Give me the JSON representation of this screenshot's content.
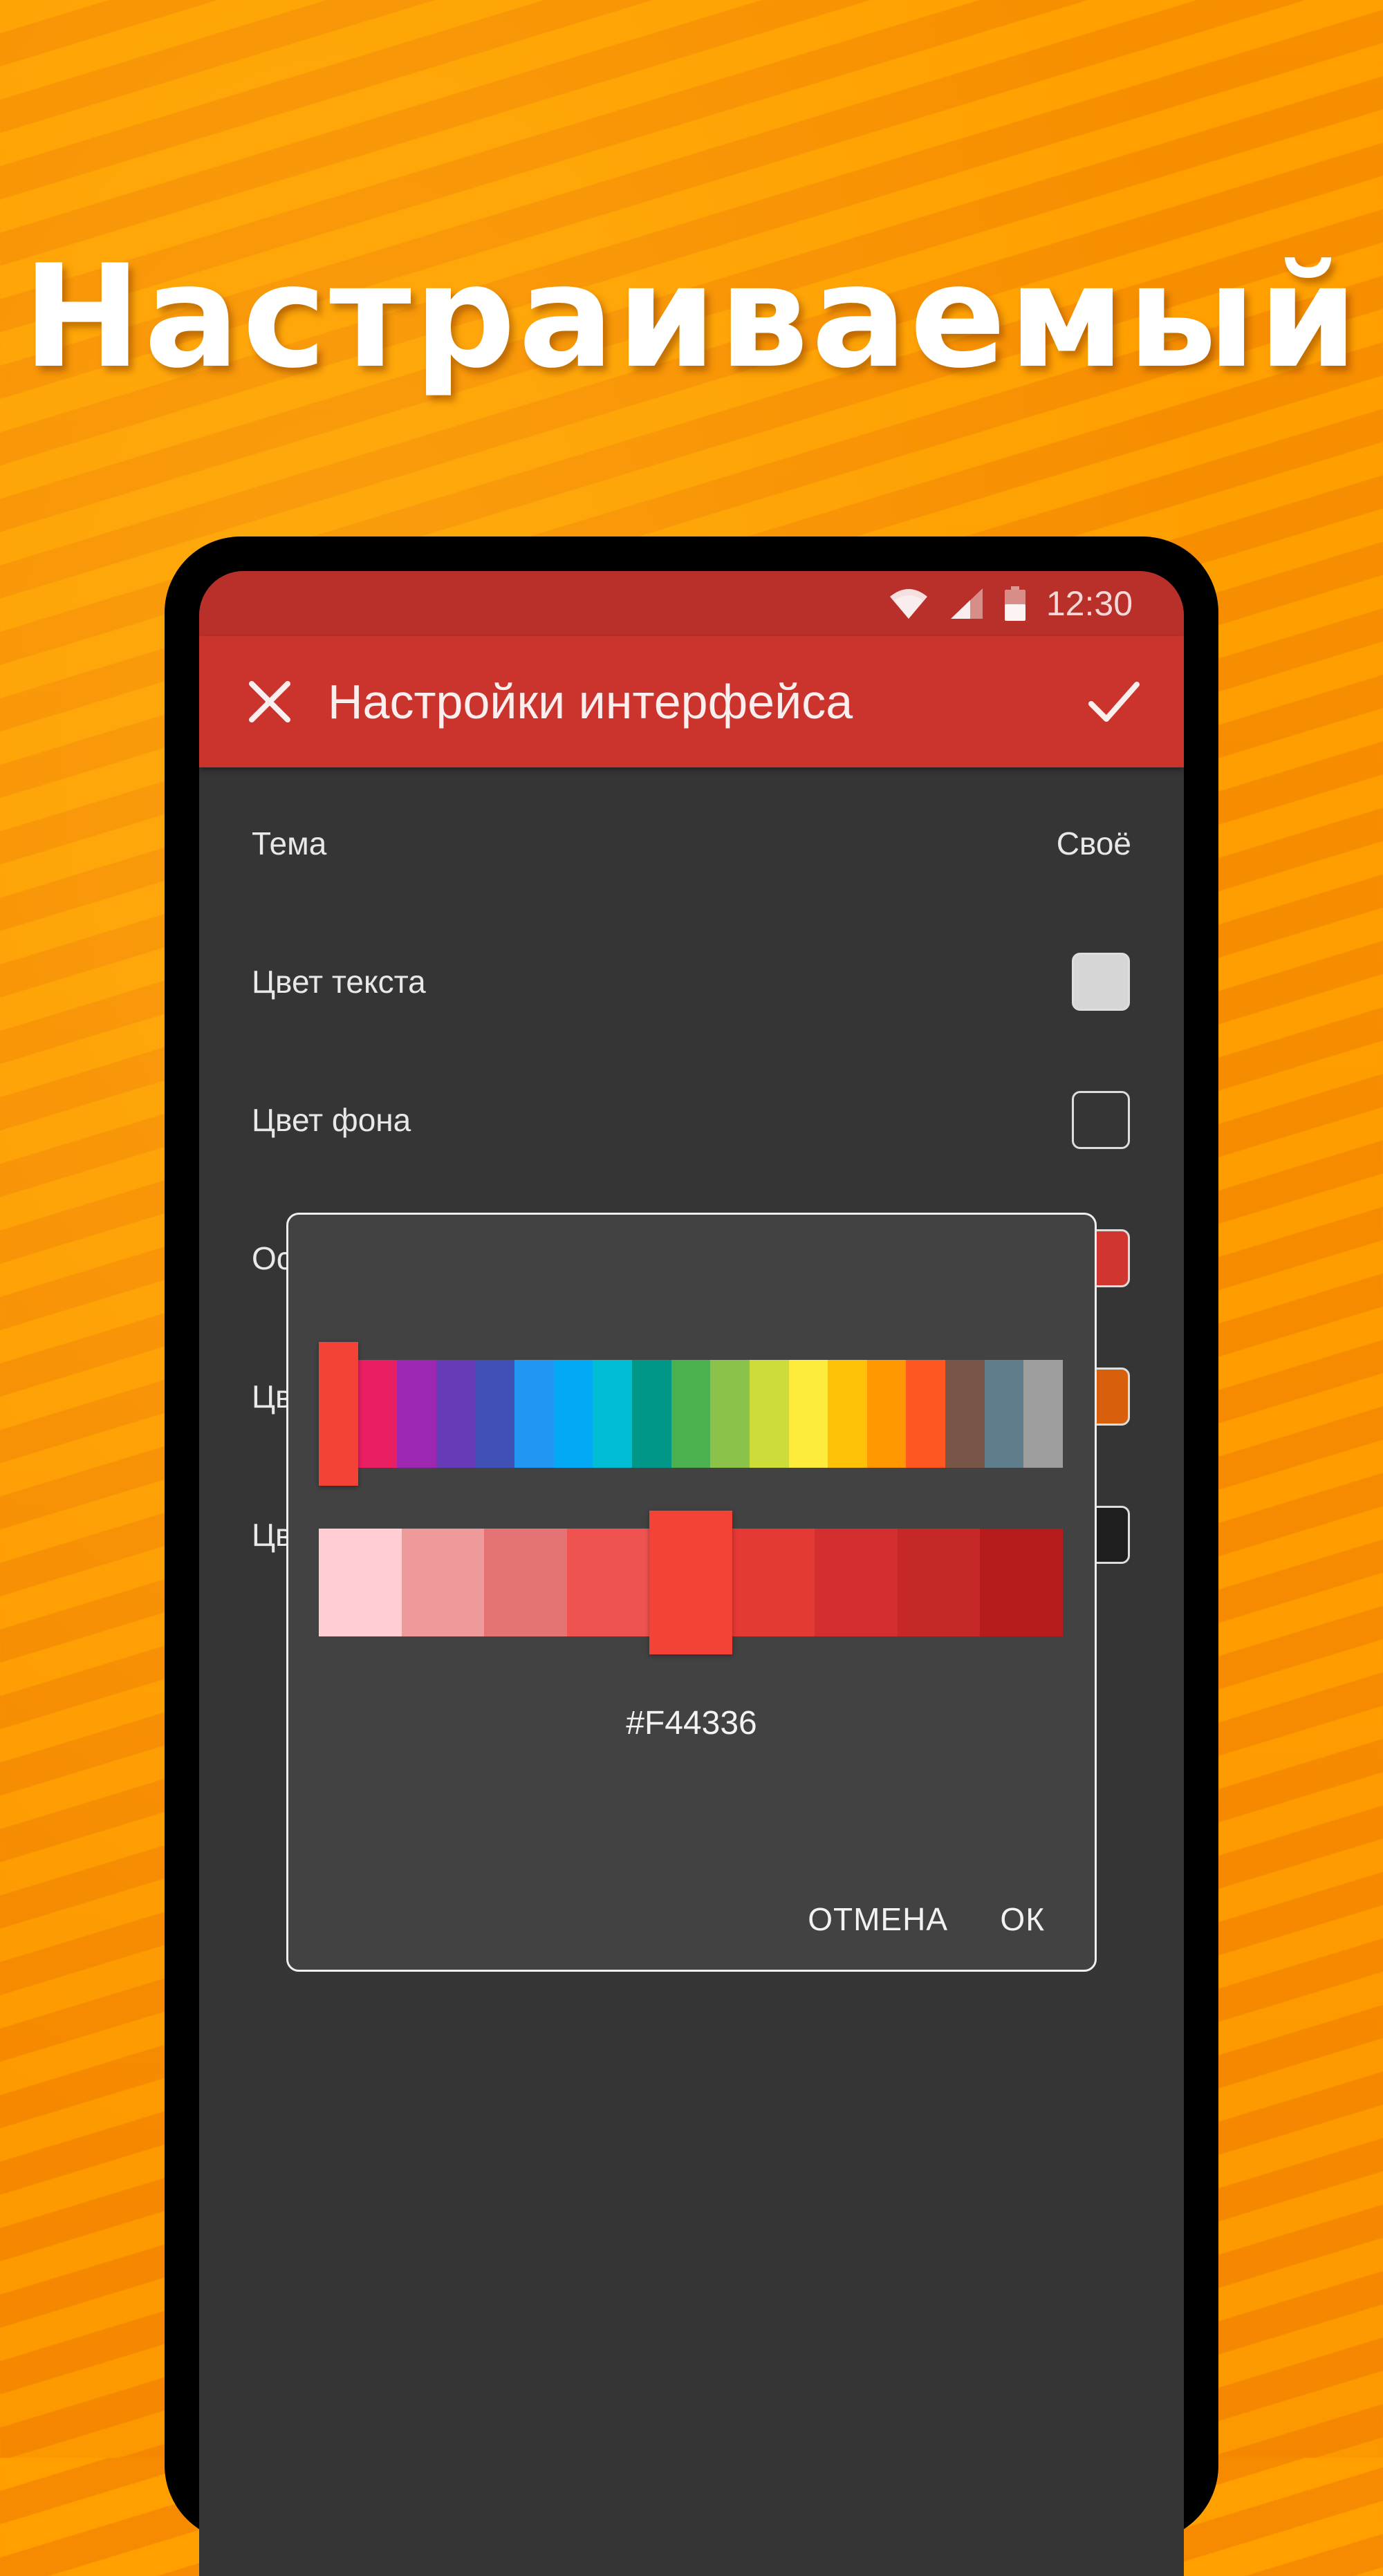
{
  "headline": "Настраиваемый",
  "status_bar": {
    "time": "12:30",
    "icons": [
      "wifi-icon",
      "signal-icon",
      "battery-icon"
    ]
  },
  "appbar": {
    "title": "Настройки интерфейса",
    "close_icon": "close-icon",
    "confirm_icon": "check-icon"
  },
  "settings": {
    "rows": [
      {
        "label": "Тема",
        "value": "Своё"
      },
      {
        "label": "Цвет текста",
        "swatch": "#d6d6d6"
      },
      {
        "label": "Цвет фона",
        "swatch": "#353535"
      },
      {
        "label": "Основной цвет",
        "swatch": "#d0362f"
      },
      {
        "label": "Цвет акцента",
        "swatch": "#d8600c"
      },
      {
        "label": "Цвет панели",
        "swatch": "#1e1e1e"
      }
    ]
  },
  "color_picker": {
    "hue_palette": [
      "#f44336",
      "#e91e63",
      "#9c27b0",
      "#673ab7",
      "#3f51b5",
      "#2196f3",
      "#03a9f4",
      "#00bcd4",
      "#009688",
      "#4caf50",
      "#8bc34a",
      "#cddc39",
      "#ffeb3b",
      "#ffc107",
      "#ff9800",
      "#ff5722",
      "#795548",
      "#607d8b",
      "#9e9e9e"
    ],
    "selected_hue": "#f44336",
    "shades": [
      "#ffcdd2",
      "#ef9a9a",
      "#e57373",
      "#ef5350",
      "#f44336",
      "#e53935",
      "#d32f2f",
      "#c62828",
      "#b71c1c"
    ],
    "selected_shade": "#f44336",
    "hex_value": "#F44336",
    "cancel_label": "ОТМЕНА",
    "ok_label": "ОК"
  },
  "colors": {
    "status_bar": "#b83029",
    "app_bar": "#ca342d",
    "screen_bg": "#353535",
    "dialog_bg": "#424242"
  }
}
